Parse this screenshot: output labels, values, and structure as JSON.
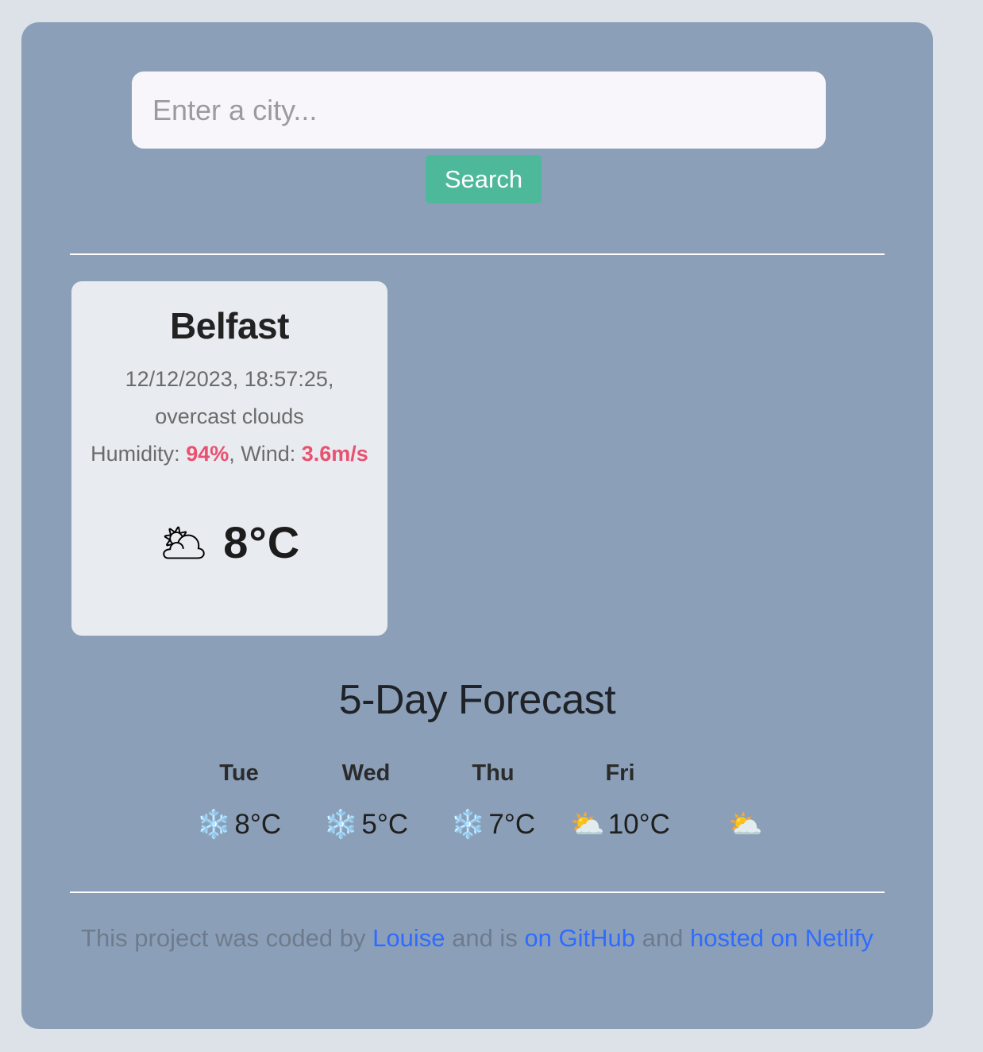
{
  "search": {
    "placeholder": "Enter a city...",
    "value": "",
    "button_label": "Search"
  },
  "current_weather": {
    "city": "Belfast",
    "datetime": "12/12/2023, 18:57:25,",
    "description": "overcast clouds",
    "humidity_label": "Humidity: ",
    "humidity_value": "94%",
    "wind_label": ", Wind: ",
    "wind_value": "3.6m/s",
    "icon": "overcast-clouds-icon",
    "icon_glyph": "🌥",
    "temperature": "8",
    "unit": "°C"
  },
  "forecast": {
    "heading": "5-Day Forecast",
    "days": [
      {
        "day": "Tue",
        "icon": "snowflake-icon",
        "icon_glyph": "❄️",
        "temp": "8°C"
      },
      {
        "day": "Wed",
        "icon": "snowflake-icon",
        "icon_glyph": "❄️",
        "temp": "5°C"
      },
      {
        "day": "Thu",
        "icon": "snowflake-icon",
        "icon_glyph": "❄️",
        "temp": "7°C"
      },
      {
        "day": "Fri",
        "icon": "sun-behind-cloud-icon",
        "icon_glyph": "⛅",
        "temp": "10°C"
      },
      {
        "day": "",
        "icon": "sun-behind-cloud-icon",
        "icon_glyph": "⛅",
        "temp": ""
      }
    ]
  },
  "footer": {
    "text_1": "This project was coded by ",
    "link_author": "Louise",
    "text_2": " and is ",
    "link_github": "on GitHub",
    "text_3": " and ",
    "link_netlify": "hosted on Netlify"
  },
  "colors": {
    "page_background": "#dde1e8",
    "panel_background": "#8ba0b8",
    "card_background": "#e8ebf0",
    "search_button": "#4db99a",
    "accent_pink": "#ea5070",
    "link_blue": "#2f6bff"
  }
}
